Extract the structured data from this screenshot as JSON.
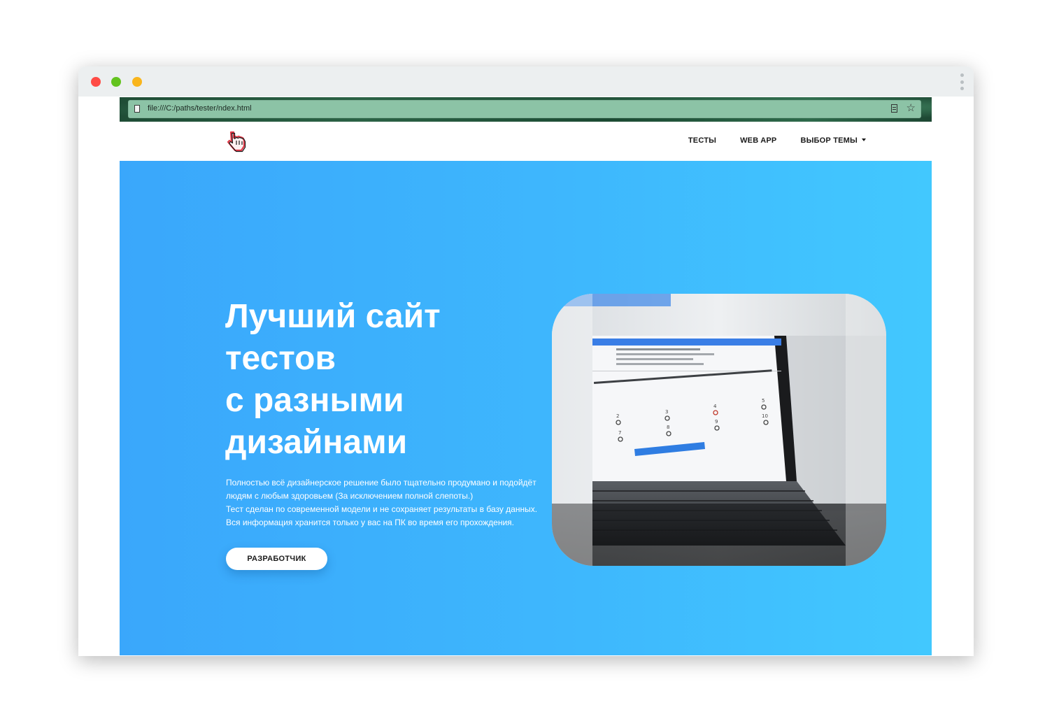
{
  "browser": {
    "url": "file:///C:/paths/tester/ndex.html"
  },
  "nav": {
    "items": [
      {
        "label": "ТЕСТЫ"
      },
      {
        "label": "WEB APP"
      },
      {
        "label": "ВЫБОР ТЕМЫ"
      }
    ]
  },
  "hero": {
    "title_lines": [
      "Лучший сайт",
      "тестов",
      "с разными",
      "дизайнами"
    ],
    "text_lines": [
      "Полностью всё дизайнерское решение было тщательно продумано и подойдёт",
      "людям с любым здоровьем (За исключением полной слепоты.)",
      "Тест сделан по современной модели и не сохраняет результаты в базу данных.",
      "Вся информация хранится только у вас на ПК во время его прохождения."
    ],
    "button_label": "РАЗРАБОТЧИК"
  },
  "laptop_screen": {
    "question": "в организацию, чем стал бы заниматься работой не связанной с моей профессией",
    "options": [
      "2",
      "3",
      "4",
      "5",
      "7",
      "8",
      "9",
      "10"
    ],
    "next_button": "Следующий вопрос"
  },
  "colors": {
    "hero_start": "#3aa7fb",
    "hero_end": "#42c8fe",
    "address_bar": "#8cc3a6"
  }
}
